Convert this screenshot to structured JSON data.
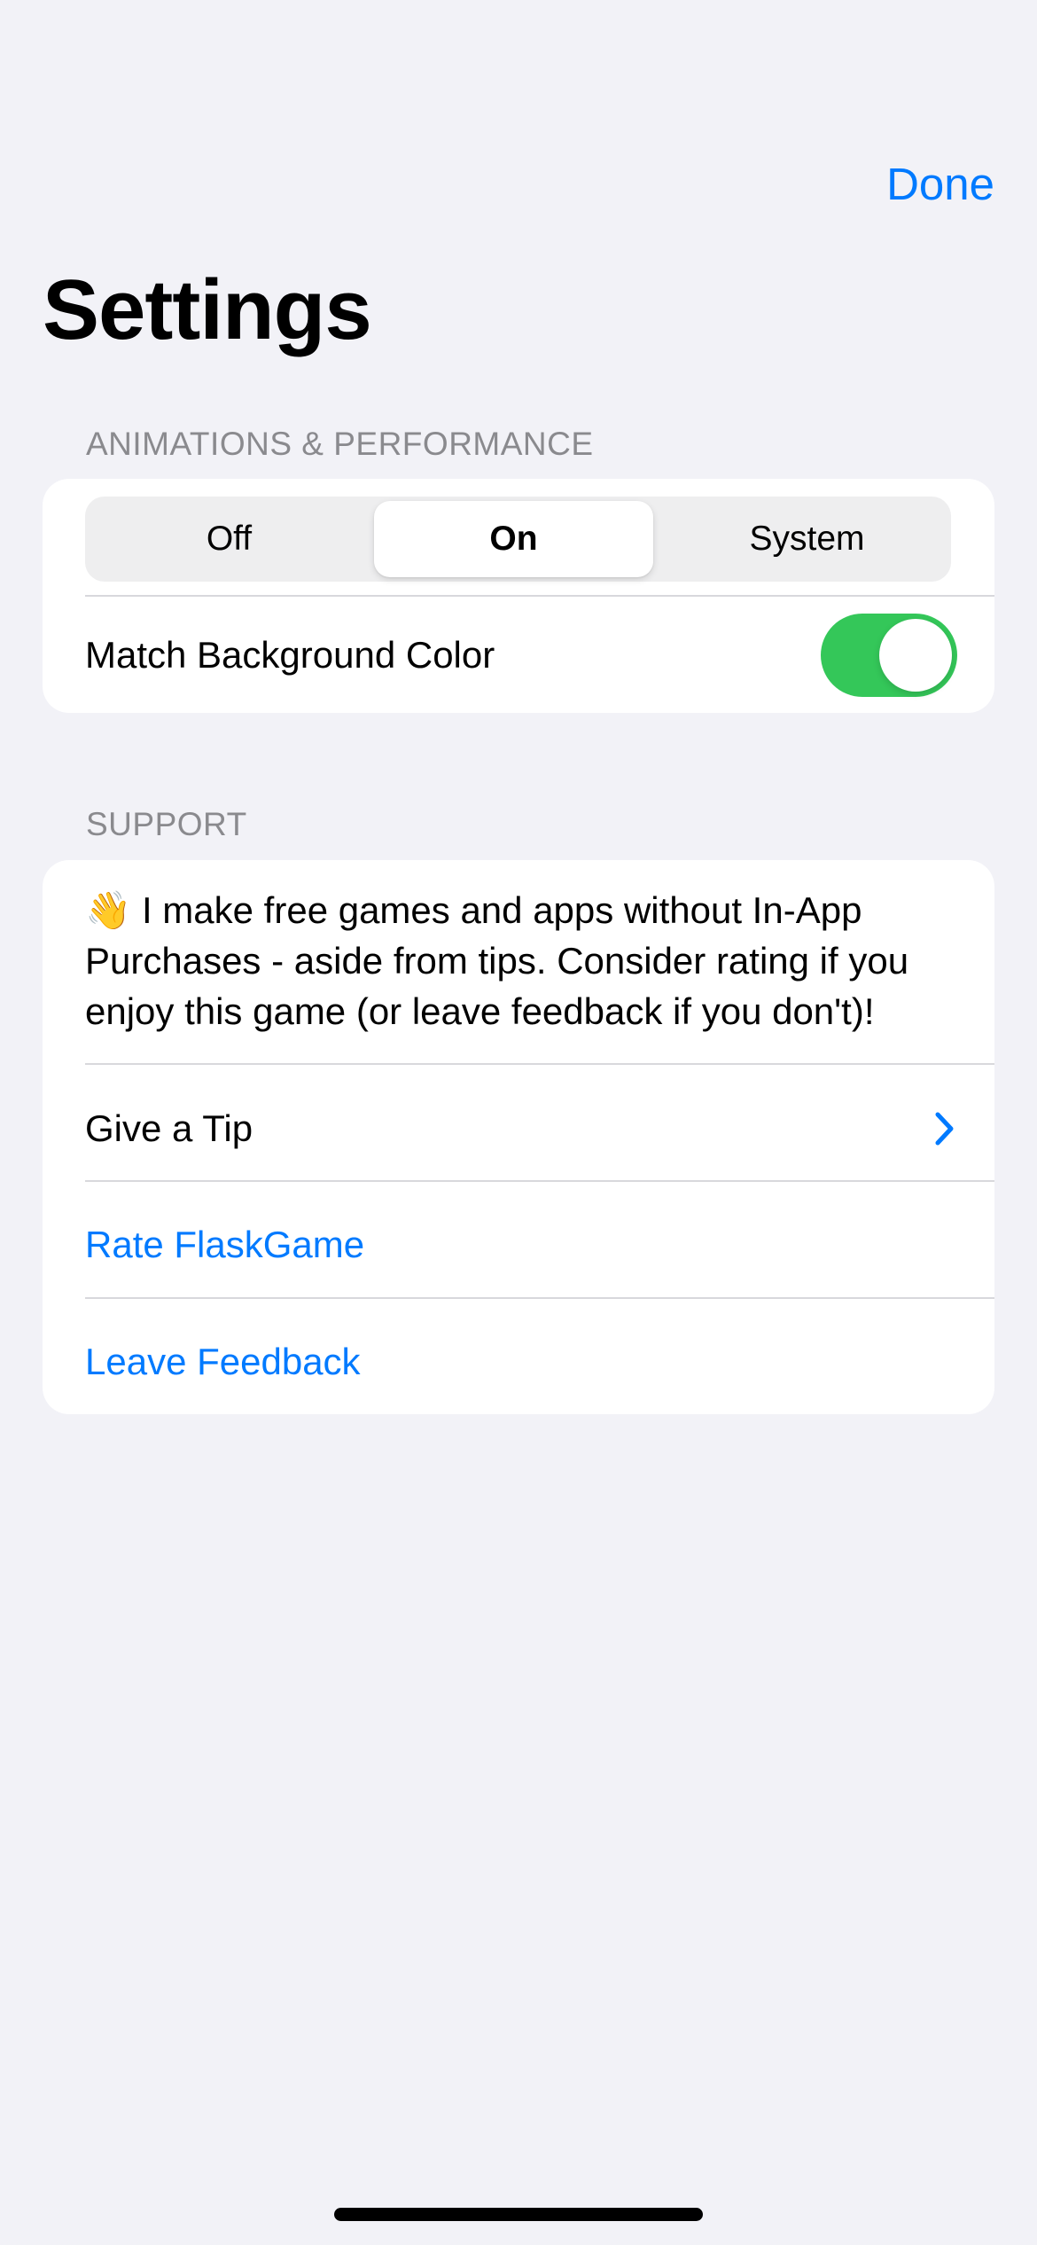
{
  "nav": {
    "done_label": "Done"
  },
  "page": {
    "title": "Settings"
  },
  "animations": {
    "header": "ANIMATIONS & PERFORMANCE",
    "segments": [
      "Off",
      "On",
      "System"
    ],
    "selected_segment": "On",
    "match_background_label": "Match Background Color",
    "match_background_on": true
  },
  "support": {
    "header": "SUPPORT",
    "emoji": "👋",
    "message": "I make free games and apps without In-App Purchases - aside from tips. Consider rating if you enjoy this game (or leave feedback if you don't)!",
    "give_tip_label": "Give a Tip",
    "rate_label": "Rate FlaskGame",
    "feedback_label": "Leave Feedback"
  },
  "colors": {
    "accent": "#007aff",
    "toggle_on": "#34c759",
    "background": "#f2f2f7"
  },
  "icons": {
    "give_tip": "chevron-right-icon",
    "greeting": "waving-hand-icon"
  }
}
